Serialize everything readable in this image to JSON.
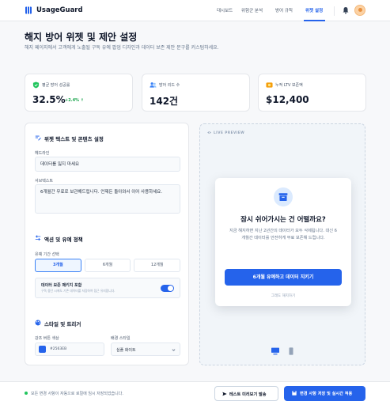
{
  "app": {
    "brand": "UsageGuard",
    "nav": [
      "대시보드",
      "위험군 분석",
      "방어 규칙",
      "위젯 설정"
    ],
    "active_nav_index": 3,
    "accent_color": "#2563eb"
  },
  "page": {
    "title": "해지 방어 위젯 및 제안 설정",
    "description": "해지 페이지에서 고객에게 노출될 구독 유예 팝업 디자인과 데이터 보존 제안 문구를 커스텀하세요."
  },
  "stats": [
    {
      "icon": "shield-check-icon",
      "label": "평균 방어 성공률",
      "value": "32.5%",
      "delta": "+2.4% ↑"
    },
    {
      "icon": "users-icon",
      "label": "방어 리드 수",
      "value": "142건"
    },
    {
      "icon": "coins-icon",
      "label": "누적 LTV 보존액",
      "value": "$12,400"
    }
  ],
  "settings": {
    "widget_section_title": "위젯 텍스트 및 콘텐츠 설정",
    "headline_label": "헤드라인",
    "headline_value": "데이터를 잃지 마세요",
    "sub_label": "서브텍스트",
    "sub_value": "6개월간 무료로 보관해드립니다. 언제든 돌아와서 이어 사용하세요.",
    "action_section_title": "액션 및 유예 정책",
    "period_label": "유예 기간 선택",
    "period_options": [
      "3개월",
      "6개월",
      "12개월"
    ],
    "period_selected_index": 0,
    "retention_title": "데이터 보존 패키지 포함",
    "retention_desc": "구독 중단 시에도 기존 데이터를 저장하여 접근 유지합니다.",
    "retention_on": true,
    "style_section_title": "스타일 및 트리거",
    "button_color_label": "강조 버튼 색상",
    "button_color_value": "#2563EB",
    "bg_style_label": "배경 스타일",
    "bg_style_value": "심플 화이트"
  },
  "preview": {
    "badge": "LIVE PREVIEW",
    "modal_title": "잠시 쉬어가시는 건 어떨까요?",
    "modal_body": "지금 해지하면 지난 2년간의 데이터가 모두 삭제됩니다. 대신 6개월간 데이터를 안전하게 무료 보존해 드립니다.",
    "cta": "6개월 유예하고 데이터 지키기",
    "secondary_link": "그래도 해지하기"
  },
  "footer": {
    "status": "모든 변경 사항이 자동으로 로컬에 임시 저장되었습니다.",
    "test_button": "테스트 미리보기 발송",
    "apply_button": "변경 사항 저장 및 실시간 적용"
  }
}
